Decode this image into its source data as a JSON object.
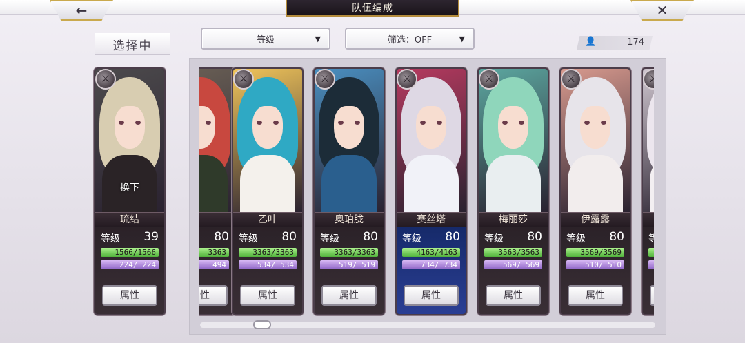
{
  "header": {
    "title": "队伍编成",
    "back_icon": "←",
    "close_icon": "✕"
  },
  "toolbar": {
    "selecting_label": "选择中",
    "sort_label": "等级",
    "filter_label": "筛选：OFF",
    "dropdown_arrow": "▼",
    "unit_count": "174"
  },
  "selected": {
    "name": "琉结",
    "swap_label": "换下",
    "level_label": "等级",
    "level": "39",
    "hp": "1566/1566",
    "mp": "224/ 224",
    "attr_label": "属性",
    "theme": {
      "hair": "#d8cdb1",
      "body": "#2a2326",
      "bg": "#4c4a4c"
    }
  },
  "cards": [
    {
      "name": "",
      "level_label": "等级",
      "level": "80",
      "hp": "3363",
      "mp": "494",
      "attr_label": "属性",
      "theme": {
        "hair": "#c8483f",
        "body": "#2f3a2a",
        "bg": "#6b6156"
      }
    },
    {
      "name": "乙叶",
      "level_label": "等级",
      "level": "80",
      "hp": "3363/3363",
      "mp": "534/ 534",
      "attr_label": "属性",
      "theme": {
        "hair": "#2fa9c4",
        "body": "#f4f1ec",
        "bg": "#f0c45a"
      }
    },
    {
      "name": "奥珀胧",
      "level_label": "等级",
      "level": "80",
      "hp": "3363/3363",
      "mp": "519/ 519",
      "attr_label": "属性",
      "theme": {
        "hair": "#1c2c38",
        "body": "#2a5f8e",
        "bg": "#4a8fc0"
      }
    },
    {
      "name": "赛丝塔",
      "level_label": "等级",
      "level": "80",
      "hp": "4163/4163",
      "mp": "734/ 734",
      "attr_label": "属性",
      "special": true,
      "theme": {
        "hair": "#ded8e4",
        "body": "#f1f2f8",
        "bg": "#b63a5f"
      }
    },
    {
      "name": "梅丽莎",
      "level_label": "等级",
      "level": "80",
      "hp": "3563/3563",
      "mp": "569/ 569",
      "attr_label": "属性",
      "theme": {
        "hair": "#8fd6bb",
        "body": "#e9eef0",
        "bg": "#5ca7a0"
      }
    },
    {
      "name": "伊露露",
      "level_label": "等级",
      "level": "80",
      "hp": "3569/3569",
      "mp": "510/ 510",
      "attr_label": "属性",
      "theme": {
        "hair": "#e7e4ea",
        "body": "#f2eded",
        "bg": "#d89a8e"
      }
    },
    {
      "name": "",
      "level_label": "等级",
      "level": "",
      "hp": "3",
      "mp": "",
      "attr_label": "属",
      "theme": {
        "hair": "#ece6ee",
        "body": "#f3eff2",
        "bg": "#cfc6cf"
      }
    }
  ]
}
